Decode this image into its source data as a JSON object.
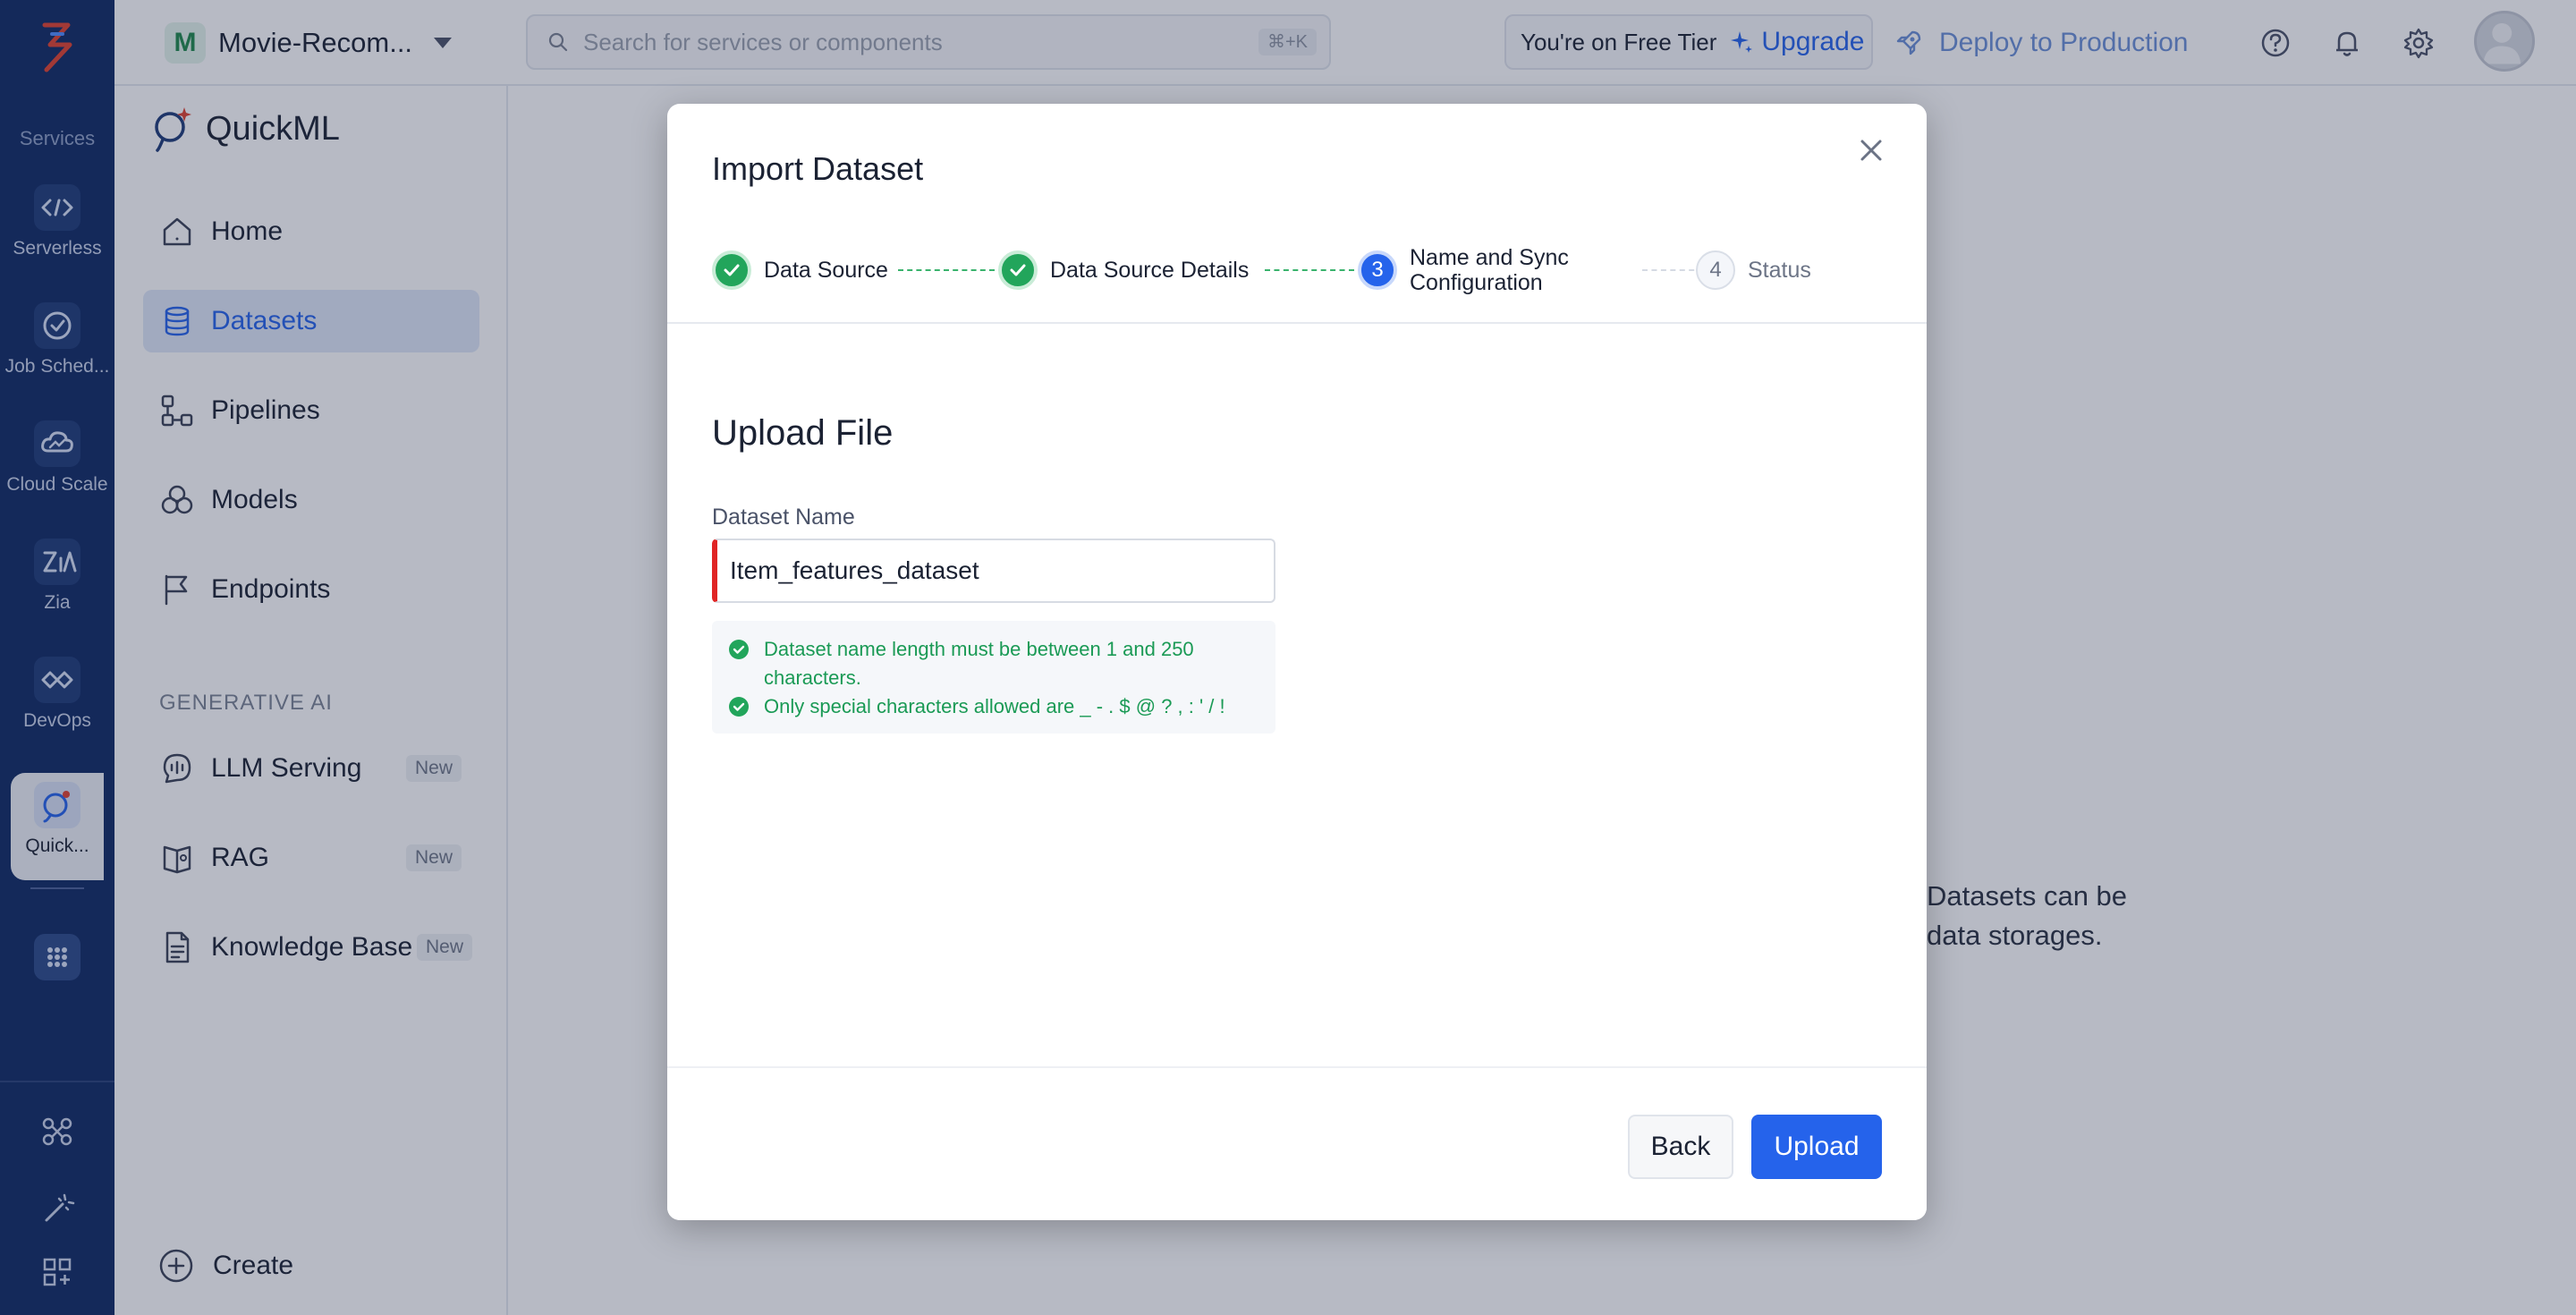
{
  "rail": {
    "section_label": "Services",
    "items": [
      {
        "label": "Serverless",
        "icon": "serverless-icon"
      },
      {
        "label": "Job Sched...",
        "icon": "job-scheduler-icon"
      },
      {
        "label": "Cloud Scale",
        "icon": "cloud-scale-icon"
      },
      {
        "label": "Zia",
        "icon": "zia-icon"
      },
      {
        "label": "DevOps",
        "icon": "devops-icon"
      },
      {
        "label": "Quick...",
        "icon": "quickml-icon"
      }
    ]
  },
  "topbar": {
    "project_initial": "M",
    "project_name": "Movie-Recom...",
    "search_placeholder": "Search for services or components",
    "search_shortcut": "⌘+K",
    "tier_text": "You're on Free Tier",
    "upgrade_label": "Upgrade",
    "deploy_label": "Deploy to Production"
  },
  "sidebar": {
    "brand": "QuickML",
    "items": [
      {
        "label": "Home"
      },
      {
        "label": "Datasets"
      },
      {
        "label": "Pipelines"
      },
      {
        "label": "Models"
      },
      {
        "label": "Endpoints"
      }
    ],
    "section_label": "GENERATIVE AI",
    "genai_items": [
      {
        "label": "LLM Serving",
        "badge": "New"
      },
      {
        "label": "RAG",
        "badge": "New"
      },
      {
        "label": "Knowledge Base",
        "badge": "New"
      }
    ],
    "create_label": "Create"
  },
  "main": {
    "empty_text_line1": "Datasets can be",
    "empty_text_line2": "data storages."
  },
  "modal": {
    "title": "Import Dataset",
    "steps": [
      {
        "label": "Data Source",
        "state": "done"
      },
      {
        "label": "Data Source Details",
        "state": "done"
      },
      {
        "number": "3",
        "label_line1": "Name and Sync",
        "label_line2": "Configuration",
        "state": "current"
      },
      {
        "number": "4",
        "label": "Status",
        "state": "todo"
      }
    ],
    "section_title": "Upload File",
    "field_label": "Dataset Name",
    "field_value": "Item_features_dataset",
    "rules": [
      {
        "text_line1": "Dataset name length must be between 1 and 250",
        "text_line2": "characters."
      },
      {
        "text_line1": "Only special characters allowed are _ - . $ @ ? , : ' / !"
      }
    ],
    "back_label": "Back",
    "upload_label": "Upload"
  },
  "colors": {
    "rail_bg": "#0f2a63",
    "primary": "#2563eb",
    "success": "#22a55b",
    "error": "#e02424"
  }
}
